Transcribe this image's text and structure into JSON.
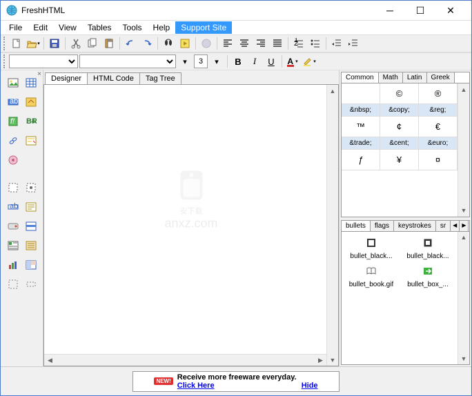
{
  "window": {
    "title": "FreshHTML"
  },
  "menu": {
    "items": [
      "File",
      "Edit",
      "View",
      "Tables",
      "Tools",
      "Help",
      "Support Site"
    ],
    "highlight_index": 6
  },
  "format": {
    "font_size": "3"
  },
  "tabs": {
    "items": [
      "Designer",
      "HTML Code",
      "Tag Tree"
    ],
    "active_index": 0
  },
  "charpanel": {
    "tabs": [
      "Common",
      "Math",
      "Latin",
      "Greek"
    ],
    "active_index": 0,
    "rows": [
      {
        "chars": [
          "",
          "©",
          "®"
        ],
        "labels": [
          "&nbsp;",
          "&copy;",
          "&reg;"
        ]
      },
      {
        "chars": [
          "™",
          "¢",
          "€"
        ],
        "labels": [
          "&trade;",
          "&cent;",
          "&euro;"
        ]
      },
      {
        "chars": [
          "ƒ",
          "¥",
          "¤"
        ],
        "labels": [
          "",
          "",
          ""
        ]
      }
    ]
  },
  "bulletpanel": {
    "tabs": [
      "bullets",
      "flags",
      "keystrokes",
      "sr"
    ],
    "active_index": 0,
    "items": [
      {
        "label": "bullet_black..."
      },
      {
        "label": "bullet_black..."
      },
      {
        "label": "bullet_book.gif"
      },
      {
        "label": "bullet_box_..."
      }
    ]
  },
  "status": {
    "badge": "NEW!",
    "text": "Receive more freeware everyday.",
    "link1": "Click Here",
    "link2": "Hide"
  },
  "watermark": {
    "line1": "安下载",
    "line2": "anxz.com"
  }
}
